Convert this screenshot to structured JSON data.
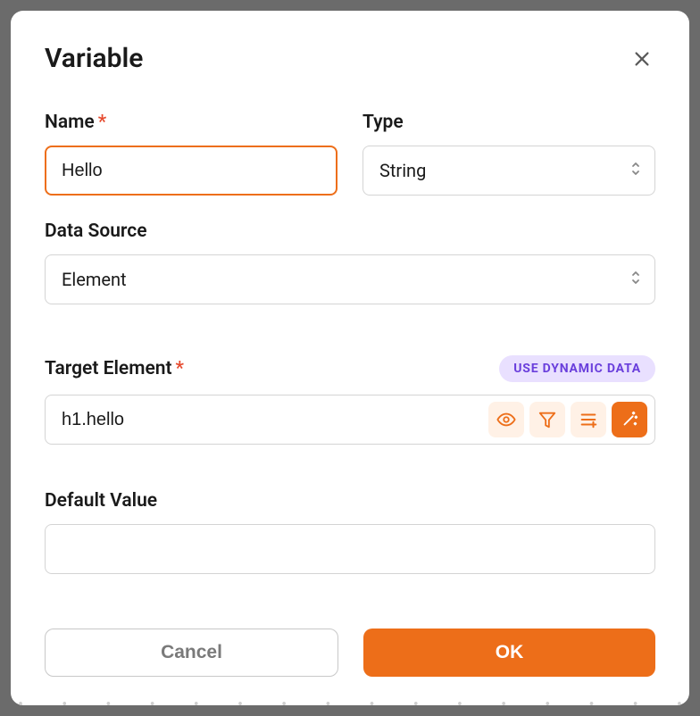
{
  "modal": {
    "title": "Variable"
  },
  "fields": {
    "name": {
      "label": "Name",
      "value": "Hello"
    },
    "type": {
      "label": "Type",
      "value": "String"
    },
    "dataSource": {
      "label": "Data Source",
      "value": "Element"
    },
    "targetElement": {
      "label": "Target Element",
      "value": "h1.hello",
      "badge": "USE DYNAMIC DATA"
    },
    "defaultValue": {
      "label": "Default Value",
      "value": ""
    }
  },
  "buttons": {
    "cancel": "Cancel",
    "ok": "OK"
  }
}
